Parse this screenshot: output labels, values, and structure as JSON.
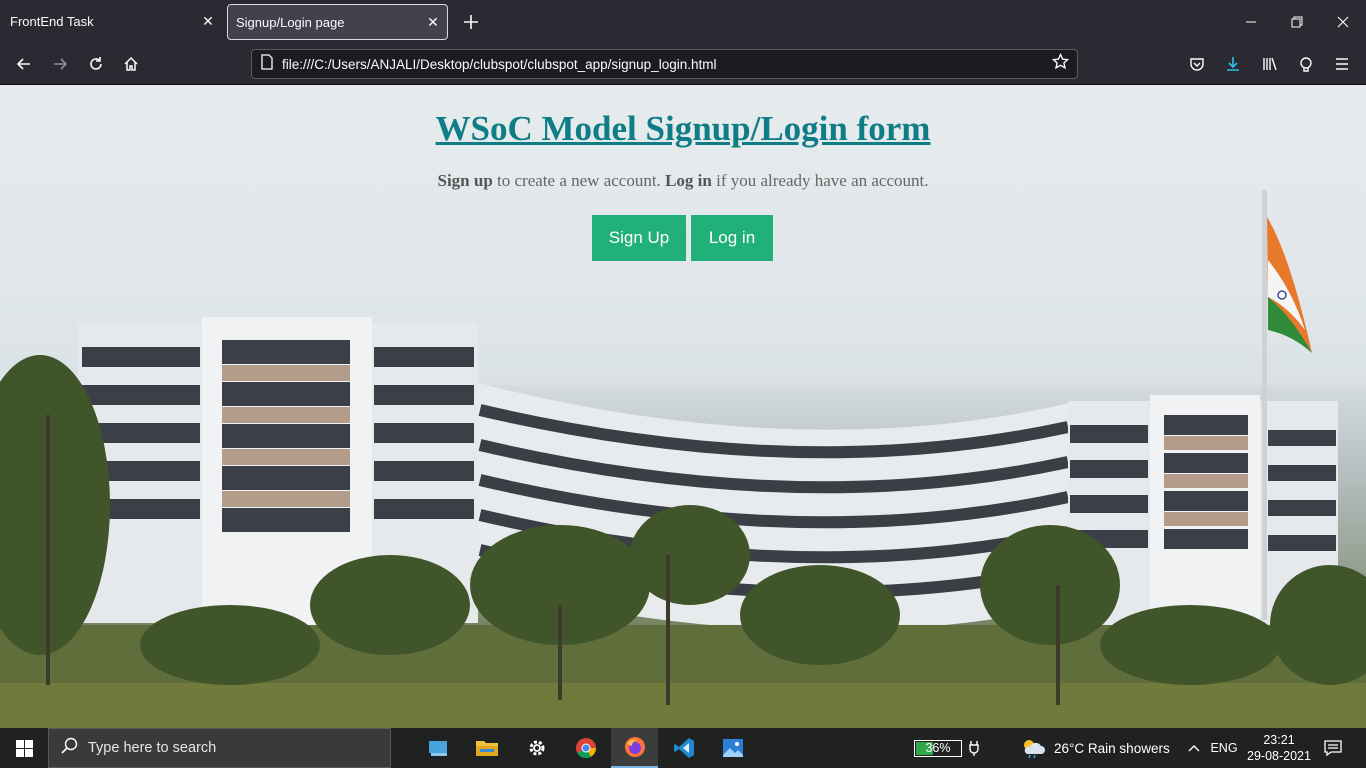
{
  "browser": {
    "tabs": [
      {
        "label": "FrontEnd Task",
        "active": false
      },
      {
        "label": "Signup/Login page",
        "active": true
      }
    ],
    "url": "file:///C:/Users/ANJALI/Desktop/clubspot/clubspot_app/signup_login.html"
  },
  "page": {
    "title": "WSoC Model Signup/Login form",
    "subtitle": {
      "signup_bold": "Sign up",
      "middle": " to create a new account. ",
      "login_bold": "Log in",
      "end": " if you already have an account."
    },
    "signup_button": "Sign Up",
    "login_button": "Log in"
  },
  "taskbar": {
    "search_placeholder": "Type here to search",
    "battery": "36%",
    "weather": "26°C  Rain showers",
    "language": "ENG",
    "time": "23:21",
    "date": "29-08-2021"
  },
  "colors": {
    "title": "#0f7d85",
    "button": "#21b07a",
    "browser_chrome": "#2b2a33",
    "taskbar": "#1f2220"
  }
}
